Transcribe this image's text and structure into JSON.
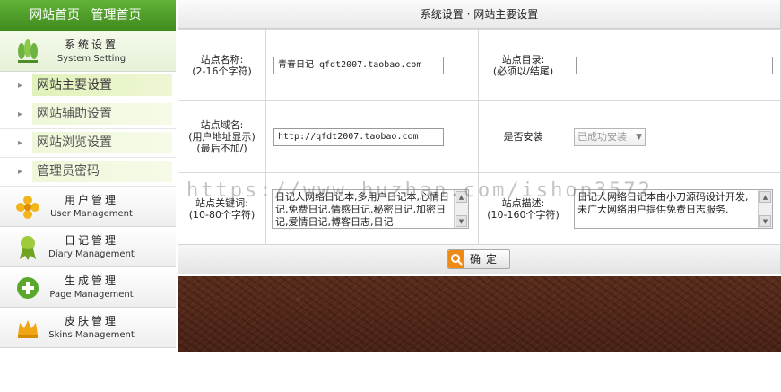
{
  "topnav": {
    "home": "网站首页",
    "admin_home": "管理首页"
  },
  "sidebar": {
    "sections": [
      {
        "cn": "系统设置",
        "en": "System Setting",
        "icon": "leaf-plant-icon"
      },
      {
        "cn": "用户管理",
        "en": "User Management",
        "icon": "user-flower-icon"
      },
      {
        "cn": "日记管理",
        "en": "Diary Management",
        "icon": "award-ribbon-icon"
      },
      {
        "cn": "生成管理",
        "en": "Page Management",
        "icon": "plus-circle-icon"
      },
      {
        "cn": "皮肤管理",
        "en": "Skins Management",
        "icon": "crown-icon"
      }
    ],
    "items": [
      {
        "label": "网站主要设置"
      },
      {
        "label": "网站辅助设置"
      },
      {
        "label": "网站浏览设置"
      },
      {
        "label": "管理员密码"
      }
    ]
  },
  "main": {
    "title": "系统设置 · 网站主要设置",
    "form": {
      "site_name_label_1": "站点名称:",
      "site_name_label_2": "(2-16个字符)",
      "site_name_value": "青春日记 qfdt2007.taobao.com",
      "site_dir_label_1": "站点目录:",
      "site_dir_label_2": "(必须以/结尾)",
      "site_dir_value": "",
      "domain_label_1": "站点域名:",
      "domain_label_2": "(用户地址显示)",
      "domain_label_3": "(最后不加/)",
      "domain_value": "http://qfdt2007.taobao.com",
      "installed_label": "是否安装",
      "installed_value": "已成功安装",
      "keywords_label_1": "站点关键词:",
      "keywords_label_2": "(10-80个字符)",
      "keywords_value": "日记人网络日记本,多用户日记本,心情日记,免费日记,情感日记,秘密日记,加密日记,爱情日记,博客日志,日记",
      "desc_label_1": "站点描述:",
      "desc_label_2": "(10-160个字符)",
      "desc_value": "日记人网络日记本由小刀源码设计开发,未广大网络用户提供免费日志服务."
    },
    "confirm_label": "确定"
  },
  "watermark": "https://www.huzhan.com/ishop3572"
}
